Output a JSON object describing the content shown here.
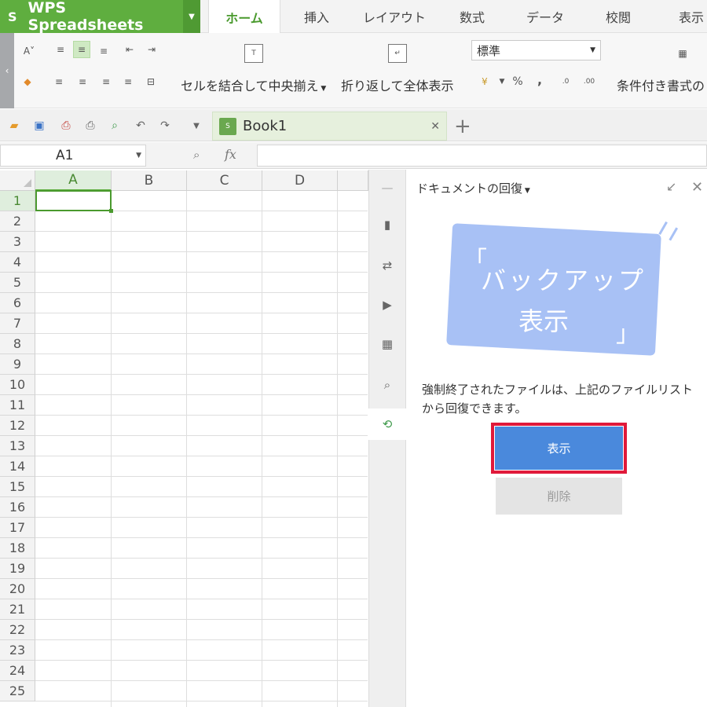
{
  "app": {
    "logo": "S",
    "name": "WPS Spreadsheets"
  },
  "menu_tabs": [
    "ホーム",
    "挿入",
    "レイアウト",
    "数式",
    "データ",
    "校閲",
    "表示"
  ],
  "ribbon": {
    "merge_label": "セルを結合して中央揃え",
    "wrap_label": "折り返して全体表示",
    "number_format": "標準",
    "percent": "%",
    "comma": ",",
    "cond_format_label": "条件付き書式の"
  },
  "tab": {
    "book_name": "Book1",
    "icon_text": "S"
  },
  "formula_bar": {
    "cell_ref": "A1",
    "fx": "fx",
    "formula": ""
  },
  "grid": {
    "columns": [
      "A",
      "B",
      "C",
      "D"
    ],
    "rows": [
      "1",
      "2",
      "3",
      "4",
      "5",
      "6",
      "7",
      "8",
      "9",
      "10",
      "11",
      "12",
      "13",
      "14",
      "15",
      "16",
      "17",
      "18",
      "19",
      "20",
      "21",
      "22",
      "23",
      "24",
      "25"
    ],
    "active_cell": "A1"
  },
  "recovery_panel": {
    "title": "ドキュメントの回復",
    "card_line1": "バックアップ",
    "card_line2": "表示",
    "description": "強制終了されたファイルは、上記のファイルリストから回復できます。",
    "show_button": "表示",
    "delete_button": "削除"
  },
  "colors": {
    "brand_green": "#5fae3f",
    "primary_button": "#4a89dc",
    "highlight": "#e0193a",
    "card": "#a8c1f5"
  }
}
